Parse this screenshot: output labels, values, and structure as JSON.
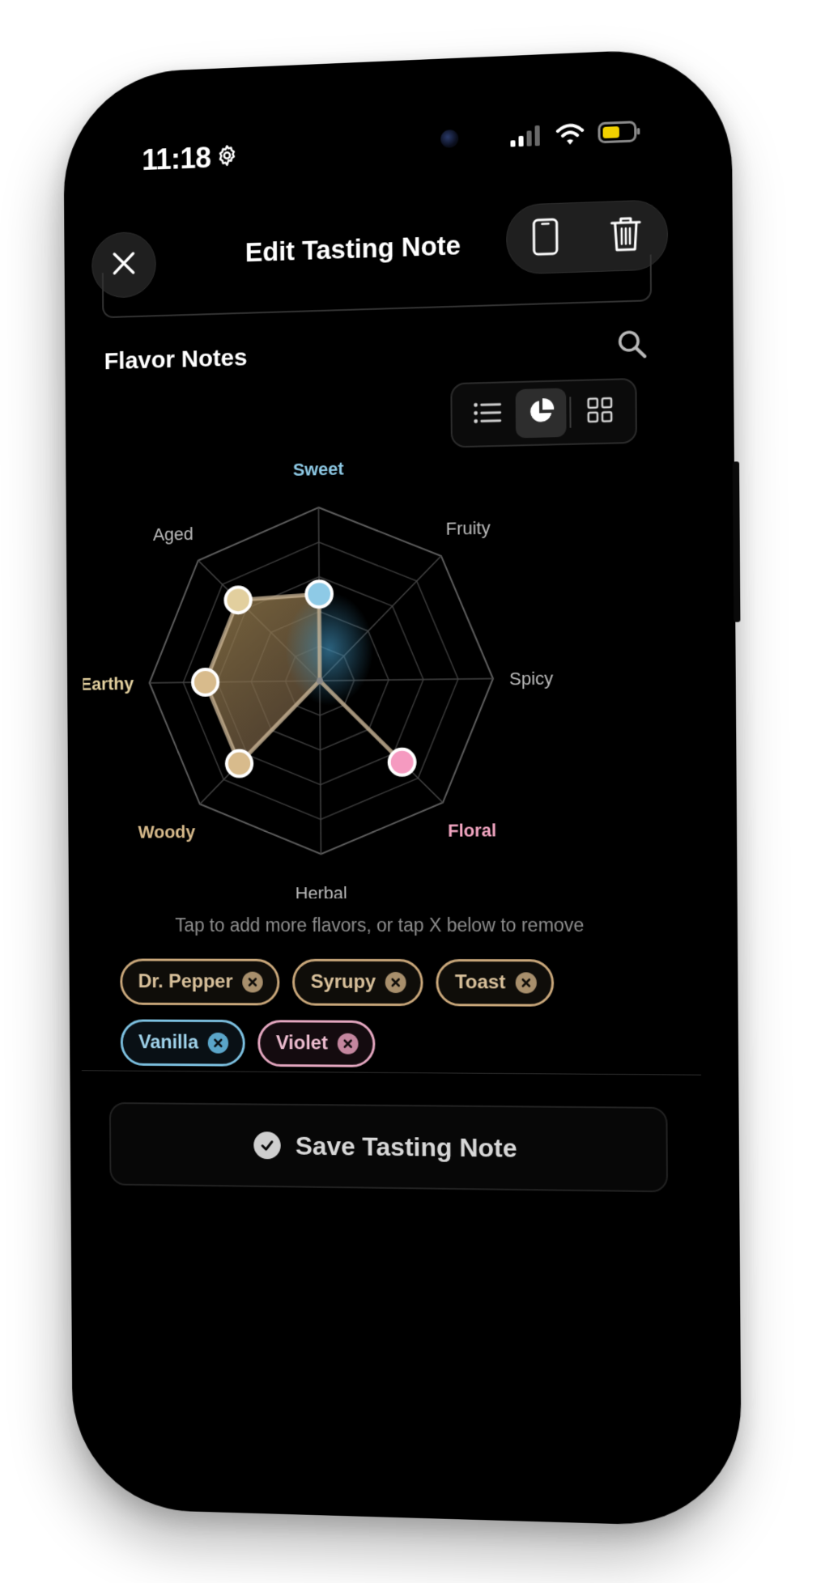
{
  "status_bar": {
    "time": "11:18",
    "settings_icon": "gear-icon",
    "signal_icon": "cellular-signal-icon",
    "wifi_icon": "wifi-icon",
    "battery_icon": "battery-icon",
    "battery_color": "#f2d100"
  },
  "header": {
    "title": "Edit Tasting Note",
    "close_icon": "close-icon",
    "actions": [
      {
        "icon": "phone-icon"
      },
      {
        "icon": "trash-icon"
      }
    ]
  },
  "flavor_notes": {
    "title": "Flavor Notes",
    "search_icon": "search-icon",
    "view_modes": [
      {
        "icon": "list-icon",
        "active": false
      },
      {
        "icon": "pie-chart-icon",
        "active": true
      },
      {
        "icon": "grid-icon",
        "active": false
      }
    ],
    "radar": {
      "axes": [
        {
          "label": "Sweet",
          "value": 0.5,
          "color": "#8ecae6",
          "highlighted": true
        },
        {
          "label": "Fruity",
          "value": 0.0,
          "color": "#bdbdbd",
          "highlighted": false
        },
        {
          "label": "Spicy",
          "value": 0.0,
          "color": "#bdbdbd",
          "highlighted": false
        },
        {
          "label": "Floral",
          "value": 0.67,
          "color": "#f3a6c2",
          "highlighted": true
        },
        {
          "label": "Herbal",
          "value": 0.0,
          "color": "#bdbdbd",
          "highlighted": false
        },
        {
          "label": "Woody",
          "value": 0.67,
          "color": "#d8bb8c",
          "highlighted": true
        },
        {
          "label": "Earthy",
          "value": 0.67,
          "color": "#e2cf9e",
          "highlighted": true
        },
        {
          "label": "Aged",
          "value": 0.67,
          "color": "#bdbdbd",
          "highlighted": false
        }
      ],
      "point_colors": {
        "Sweet": "#8ecae6",
        "Floral": "#f59ac0",
        "Woody": "#d8bb8c",
        "Earthy": "#d8bb8c",
        "Aged": "#e2cf9e"
      }
    },
    "hint": "Tap to add more flavors, or tap X below to remove",
    "chips": [
      [
        {
          "label": "Dr. Pepper",
          "style": "tan"
        },
        {
          "label": "Syrupy",
          "style": "tan"
        },
        {
          "label": "Toast",
          "style": "tan"
        }
      ],
      [
        {
          "label": "Vanilla",
          "style": "blue"
        },
        {
          "label": "Violet",
          "style": "pink"
        }
      ]
    ]
  },
  "save_button": {
    "label": "Save Tasting Note",
    "icon": "checkmark-circle-icon"
  }
}
